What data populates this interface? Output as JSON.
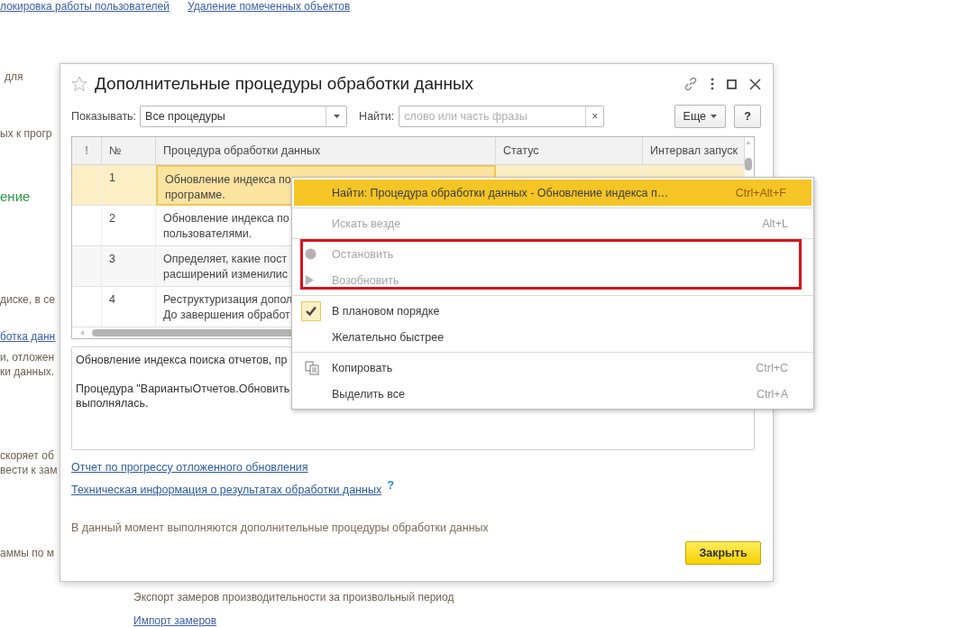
{
  "background_items": [
    {
      "kind": "link",
      "text": "локировка работы пользователей"
    },
    {
      "kind": "link",
      "text": "Удаление помеченных объектов"
    },
    {
      "kind": "text",
      "text": "для"
    },
    {
      "kind": "text",
      "text": "ых к прогр"
    },
    {
      "kind": "heading",
      "text": "ение"
    },
    {
      "kind": "text",
      "text": "диске, в се"
    },
    {
      "kind": "link",
      "text": "ботка данн"
    },
    {
      "kind": "text",
      "text": "и, отложен"
    },
    {
      "kind": "text",
      "text": "ки данных."
    },
    {
      "kind": "text",
      "text": "скоряет об"
    },
    {
      "kind": "text",
      "text": "вести к зам"
    },
    {
      "kind": "text",
      "text": "аммы по м"
    },
    {
      "kind": "text",
      "text": "Экспорт замеров производительности за произвольный период"
    },
    {
      "kind": "link",
      "text": "Импорт замеров"
    }
  ],
  "dialog": {
    "title": "Дополнительные процедуры обработки данных",
    "show_label": "Показывать:",
    "show_value": "Все процедуры",
    "find_label": "Найти:",
    "find_placeholder": "слово или часть фразы",
    "clear": "×",
    "more_button": "Еще",
    "help_button": "?",
    "table": {
      "columns": [
        "!",
        "№",
        "Процедура обработки данных",
        "Статус",
        "Интервал запуск"
      ],
      "rows": [
        {
          "number": "1",
          "procedure": "Обновление индекса по\nпрограмме.",
          "selected": true
        },
        {
          "number": "2",
          "procedure": "Обновление индекса по\nпользователями.",
          "selected": false
        },
        {
          "number": "3",
          "procedure": "Определяет, какие пост\nрасширений изменилис",
          "selected": false
        },
        {
          "number": "4",
          "procedure": "Реструктуризация допол\nДо завершения обработ",
          "selected": false
        }
      ]
    },
    "details": "Обновление индекса поиска отчетов, пр\n\nПроцедура \"ВариантыОтчетов.Обновить\nвыполнялась.",
    "links": [
      "Отчет по прогрессу отложенного обновления",
      "Техническая информация о результатах обработки данных"
    ],
    "help_mark": "?",
    "status_text": "В данный момент выполняются дополнительные процедуры обработки данных",
    "close_button": "Закрыть"
  },
  "context_menu": [
    {
      "kind": "plain",
      "label": "Найти: Процедура обработки данных - Обновление индекса п…",
      "shortcut": "Ctrl+Alt+F",
      "selected": true,
      "disabled": false
    },
    {
      "kind": "separator"
    },
    {
      "kind": "plain",
      "label": "Искать везде",
      "shortcut": "Alt+L",
      "selected": false,
      "disabled": true
    },
    {
      "kind": "separator"
    },
    {
      "kind": "stop",
      "label": "Остановить",
      "selected": false,
      "disabled": true
    },
    {
      "kind": "resume",
      "label": "Возобновить",
      "selected": false,
      "disabled": true
    },
    {
      "kind": "separator"
    },
    {
      "kind": "check",
      "label": "В плановом порядке",
      "selected": false,
      "disabled": false,
      "checked": true
    },
    {
      "kind": "check",
      "label": "Желательно быстрее",
      "selected": false,
      "disabled": false,
      "checked": false
    },
    {
      "kind": "separator"
    },
    {
      "kind": "copy",
      "label": "Копировать",
      "shortcut": "Ctrl+C",
      "selected": false,
      "disabled": false
    },
    {
      "kind": "plain",
      "label": "Выделить все",
      "shortcut": "Ctrl+A",
      "selected": false,
      "disabled": false
    }
  ]
}
